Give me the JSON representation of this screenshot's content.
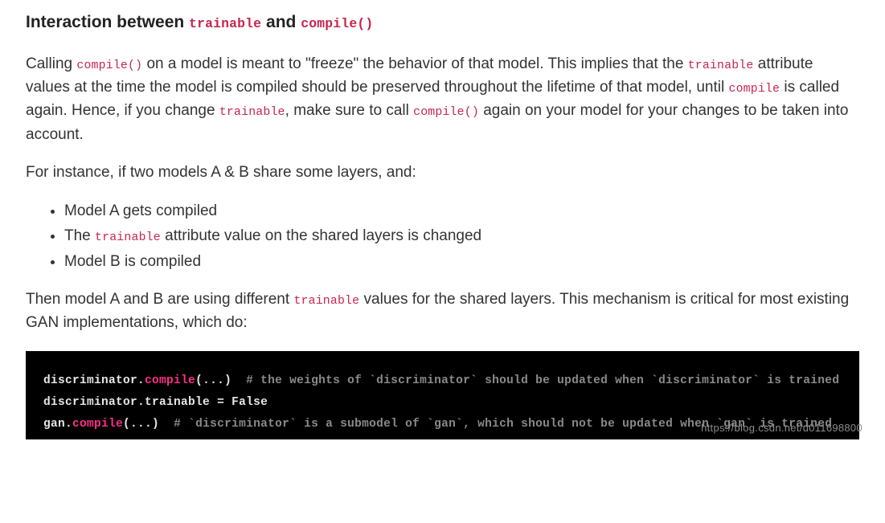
{
  "heading": {
    "t1": "Interaction between ",
    "c1": "trainable",
    "t2": " and ",
    "c2": "compile()"
  },
  "p1": {
    "s1": "Calling ",
    "c1": "compile()",
    "s2": " on a model is meant to \"freeze\" the behavior of that model. This implies that the ",
    "c2": "trainable",
    "s3": " attribute values at the time the model is compiled should be preserved throughout the lifetime of that model, until ",
    "c3": "compile",
    "s4": " is called again. Hence, if you change ",
    "c4": "trainable",
    "s5": ", make sure to call ",
    "c5": "compile()",
    "s6": " again on your model for your changes to be taken into account."
  },
  "p2": "For instance, if two models A & B share some layers, and:",
  "bullets": {
    "b1": "Model A gets compiled",
    "b2a": "The ",
    "b2c": "trainable",
    "b2b": " attribute value on the shared layers is changed",
    "b3": "Model B is compiled"
  },
  "p3": {
    "s1": "Then model A and B are using different ",
    "c1": "trainable",
    "s2": " values for the shared layers. This mechanism is critical for most existing GAN implementations, which do:"
  },
  "code": {
    "l1": {
      "ident": "discriminator",
      "dot": ".",
      "method": "compile",
      "paren": "(...)",
      "sp": "  ",
      "comment": "# the weights of `discriminator` should be updated when `discriminator` is trained"
    },
    "l2": {
      "ident": "discriminator",
      "dot": ".",
      "attr": "trainable ",
      "eq": "= ",
      "kw": "False"
    },
    "l3": {
      "ident": "gan",
      "dot": ".",
      "method": "compile",
      "paren": "(...)",
      "sp": "  ",
      "comment": "# `discriminator` is a submodel of `gan`, which should not be updated when `gan` is trained"
    }
  },
  "watermark": "https://blog.csdn.net/u011698800"
}
